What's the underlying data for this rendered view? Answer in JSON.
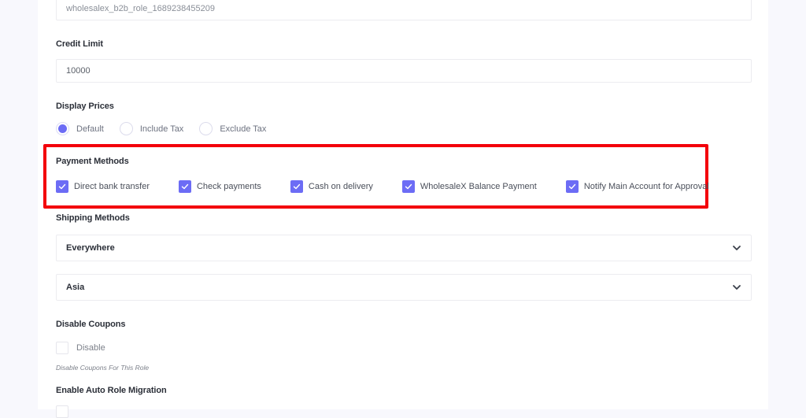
{
  "role_id_field": {
    "value": "wholesalex_b2b_role_1689238455209"
  },
  "credit_limit": {
    "label": "Credit Limit",
    "value": "10000"
  },
  "display_prices": {
    "label": "Display Prices",
    "options": [
      {
        "label": "Default",
        "checked": true
      },
      {
        "label": "Include Tax",
        "checked": false
      },
      {
        "label": "Exclude Tax",
        "checked": false
      }
    ]
  },
  "payment_methods": {
    "label": "Payment Methods",
    "highlight_color": "#f3000b",
    "options": [
      {
        "label": "Direct bank transfer",
        "checked": true
      },
      {
        "label": "Check payments",
        "checked": true
      },
      {
        "label": "Cash on delivery",
        "checked": true
      },
      {
        "label": "WholesaleX Balance Payment",
        "checked": true
      },
      {
        "label": "Notify Main Account for Approval",
        "checked": true
      }
    ]
  },
  "shipping_methods": {
    "label": "Shipping Methods",
    "zones": [
      {
        "title": "Everywhere",
        "icon": "chevron-down-icon"
      },
      {
        "title": "Asia",
        "icon": "chevron-down-icon"
      }
    ]
  },
  "disable_coupons": {
    "label": "Disable Coupons",
    "option_label": "Disable",
    "checked": false,
    "help": "Disable Coupons For This Role"
  },
  "auto_role_migration": {
    "label": "Enable Auto Role Migration"
  },
  "colors": {
    "accent": "#6c6cf5",
    "page_bg": "#f8f8fd"
  }
}
